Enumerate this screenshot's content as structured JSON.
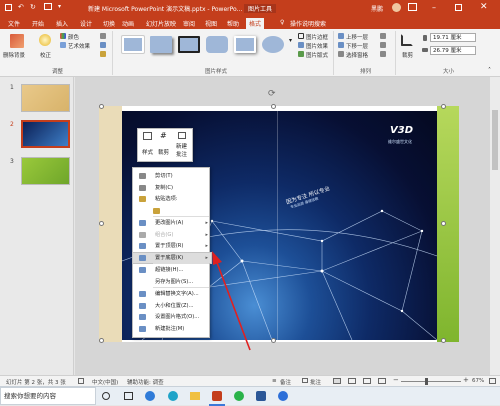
{
  "titlebar": {
    "doc_title": "新建 Microsoft PowerPoint 演示文稿.pptx - PowerPo...",
    "tool_context": "图片工具",
    "user": "黑鹏",
    "share": "共享"
  },
  "tabs": [
    "文件",
    "开始",
    "插入",
    "设计",
    "切换",
    "动画",
    "幻灯片放映",
    "审阅",
    "视图",
    "帮助",
    "格式"
  ],
  "tell_me": "操作说明搜索",
  "ribbon": {
    "remove_bg": "删除背景",
    "correct": "校正",
    "color": "颜色",
    "artistic": "艺术效果",
    "adjust_group": "调整",
    "styles_group": "图片样式",
    "border": "图片边框",
    "effects": "图片效果",
    "layout": "图片版式",
    "bring_forward": "上移一层",
    "send_backward": "下移一层",
    "selection_pane": "选择窗格",
    "arrange_group": "排列",
    "crop": "裁剪",
    "height": "19.71 厘米",
    "width": "26.79 厘米",
    "size_group": "大小"
  },
  "slides": [
    {
      "num": "1",
      "colors": [
        "#e9c98a",
        "#d8b36a"
      ]
    },
    {
      "num": "2",
      "colors": [
        "#0b1f55",
        "#3e7fc8"
      ]
    },
    {
      "num": "3",
      "colors": [
        "#9ac93b",
        "#6fa62a"
      ]
    }
  ],
  "minibar": {
    "style": "样式",
    "crop": "裁剪",
    "comment_line1": "新建",
    "comment_line2": "批注"
  },
  "slide": {
    "logo": "V3D",
    "logo_sub": "维尔盛世文化",
    "tagline": "因为专注 所以专业",
    "tagline_sub": "专业品质 值得信赖"
  },
  "context_menu": [
    {
      "label": "剪切(T)",
      "icon": "scissors-icon",
      "color": "#888"
    },
    {
      "label": "复制(C)",
      "icon": "copy-icon",
      "color": "#888"
    },
    {
      "label": "粘贴选项:",
      "icon": "paste-icon",
      "color": "#c9a23b"
    },
    {
      "label": "",
      "icon": "paste-option-icon",
      "color": "#c9a23b"
    },
    {
      "label": "更改图片(A)",
      "icon": "change-picture-icon",
      "color": "#6a8fc4",
      "sub": true
    },
    {
      "label": "组合(G)",
      "icon": "group-icon",
      "color": "#aaa",
      "sub": true,
      "disabled": true
    },
    {
      "label": "置于顶层(R)",
      "icon": "bring-front-icon",
      "color": "#6a8fc4",
      "sub": true
    },
    {
      "label": "置于底层(K)",
      "icon": "send-back-icon",
      "color": "#6a8fc4",
      "sub": true,
      "highlight": true
    },
    {
      "label": "超链接(H)...",
      "icon": "link-icon",
      "color": "#6a8fc4"
    },
    {
      "label": "另存为图片(S)...",
      "icon": "",
      "color": ""
    },
    {
      "label": "编辑替换文字(A)...",
      "icon": "alt-text-icon",
      "color": "#6a8fc4"
    },
    {
      "label": "大小和位置(Z)...",
      "icon": "size-position-icon",
      "color": "#6a8fc4"
    },
    {
      "label": "设置图片格式(O)...",
      "icon": "format-picture-icon",
      "color": "#6a8fc4"
    },
    {
      "label": "新建批注(M)",
      "icon": "comment-icon",
      "color": "#6a8fc4"
    }
  ],
  "status": {
    "slide_info": "幻灯片 第 2 张，共 3 张",
    "language": "中文(中国)",
    "accessibility": "辅助功能: 调查",
    "notes": "备注",
    "comments": "批注",
    "zoom": "67%"
  },
  "taskbar": {
    "search_placeholder": "搜索你想要的内容"
  }
}
